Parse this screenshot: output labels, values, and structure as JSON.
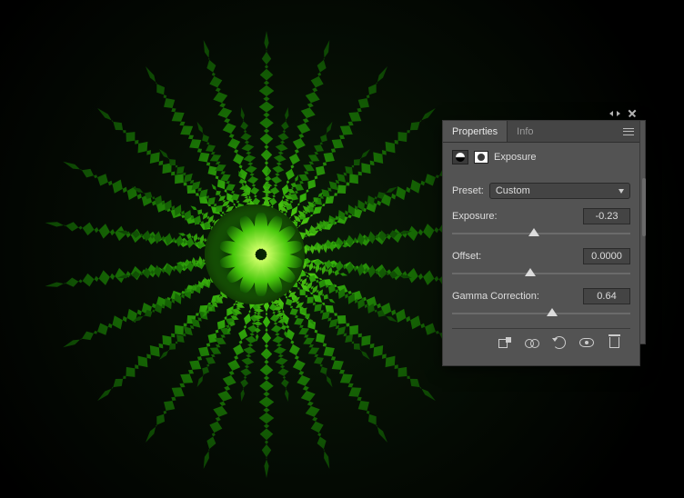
{
  "tabs": {
    "properties": "Properties",
    "info": "Info"
  },
  "adjustment": {
    "name": "Exposure"
  },
  "preset": {
    "label": "Preset:",
    "value": "Custom"
  },
  "sliders": {
    "exposure": {
      "label": "Exposure:",
      "value": "-0.23",
      "pos": 46
    },
    "offset": {
      "label": "Offset:",
      "value": "0.0000",
      "pos": 44
    },
    "gamma": {
      "label": "Gamma Correction:",
      "value": "0.64",
      "pos": 56
    }
  }
}
